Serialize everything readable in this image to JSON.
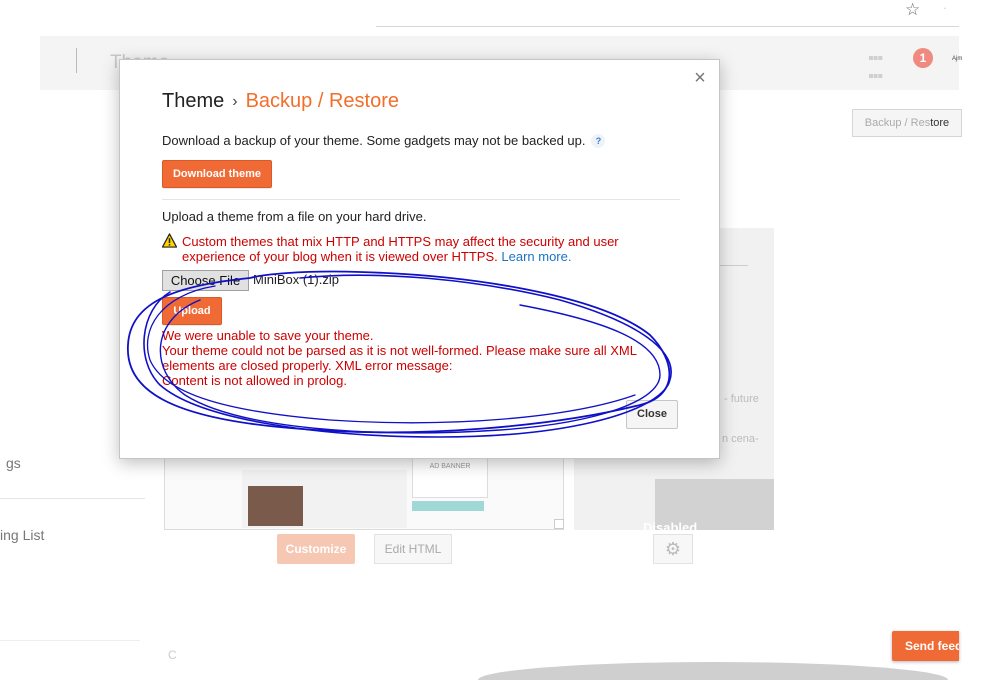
{
  "background": {
    "header_title": "Theme",
    "notification_count": "1",
    "avatar_text": "Ajm",
    "backup_restore_button": {
      "dim": "Backup / Res",
      "rest": "tore"
    },
    "sidebar_items": [
      "gs",
      "ing List"
    ],
    "bottom_text": "C",
    "thumb_ad_label": "AD BANNER",
    "customize_label": "Customize",
    "edit_html_label": "Edit HTML",
    "mobile_text_1": "- future",
    "mobile_text_2": "n cena-",
    "mobile_disabled_label": "Disabled",
    "send_feedback_label": "Send feedback"
  },
  "dialog": {
    "title_main": "Theme",
    "title_separator": "›",
    "title_sub": "Backup / Restore",
    "download_text": "Download a backup of your theme. Some gadgets may not be backed up.",
    "help_label": "?",
    "download_button": "Download theme",
    "upload_text": "Upload a theme from a file on your hard drive.",
    "warning_text": "Custom themes that mix HTTP and HTTPS may affect the security and user experience of your blog when it is viewed over HTTPS.",
    "learn_more": "Learn more.",
    "choose_file_button": "Choose File",
    "file_name": "MiniBox (1).zip",
    "upload_button": "Upload",
    "error_lines": [
      "We were unable to save your theme.",
      "Your theme could not be parsed as it is not well-formed. Please make sure all XML",
      "elements are closed properly. XML error message:",
      "Content is not allowed in prolog."
    ],
    "close_button": "Close",
    "close_x": "×"
  },
  "icons": {
    "star": "star-icon",
    "apps": "apps-grid-icon",
    "warning": "warning-triangle-icon",
    "gear": "gear-icon",
    "close": "close-icon"
  },
  "colors": {
    "accent": "#f06a35",
    "error": "#cc0000",
    "link": "#1a73c7",
    "annotation": "#1010c8"
  }
}
